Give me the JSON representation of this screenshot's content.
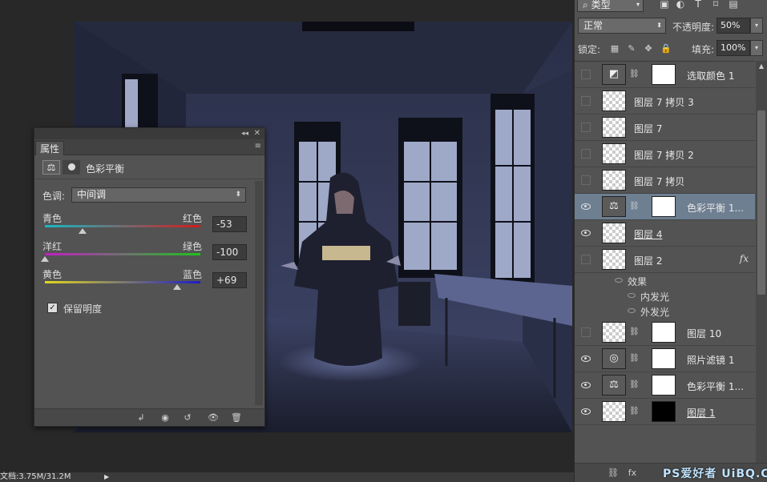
{
  "properties_panel": {
    "tab_label": "属性",
    "title": "色彩平衡",
    "collapse_glyph": "◂◂",
    "close_glyph": "✕",
    "menu_glyph": "≡",
    "balance_icon_glyph": "⚖",
    "tone_label": "色调:",
    "tone_value": "中间调",
    "sliders": [
      {
        "left": "青色",
        "right": "红色",
        "value": "-53",
        "percent": 24
      },
      {
        "left": "洋红",
        "right": "绿色",
        "value": "-100",
        "percent": 0
      },
      {
        "left": "黄色",
        "right": "蓝色",
        "value": "+69",
        "percent": 85
      }
    ],
    "preserve_label": "保留明度",
    "preserve_checked_glyph": "✓",
    "bottom_glyphs": {
      "clip": "↲",
      "view_prev": "◉",
      "reset": "↺",
      "visibility": "👁",
      "delete": "🗑"
    }
  },
  "status_bar": {
    "text": "文档:3.75M/31.2M",
    "arrow": "▶"
  },
  "layers_panel": {
    "filter_kind": "类型",
    "filter_search_glyph": "⌕",
    "filter_icons": [
      "▣",
      "◐",
      "T",
      "⌑",
      "▤"
    ],
    "blend_mode": "正常",
    "opacity_label": "不透明度:",
    "opacity_value": "50%",
    "lock_label": "锁定:",
    "lock_icons": [
      "▦",
      "✎",
      "✥",
      "🔒"
    ],
    "fill_label": "填充:",
    "fill_value": "100%",
    "dropdown_arrow": "▾",
    "chain_glyph": "⛓",
    "clip_glyph": "↲",
    "fx_glyph": "fx",
    "layers": [
      {
        "name": "选取颜色 1",
        "visible": false,
        "thumb": "adj",
        "thumb_glyph": "◩",
        "mask": "white"
      },
      {
        "name": "图层 7 拷贝 3",
        "visible": false,
        "thumb": "checker"
      },
      {
        "name": "图层 7",
        "visible": false,
        "thumb": "checker"
      },
      {
        "name": "图层 7 拷贝 2",
        "visible": false,
        "thumb": "checker"
      },
      {
        "name": "图层 7 拷贝",
        "visible": false,
        "thumb": "checker"
      },
      {
        "name": "色彩平衡 1...",
        "visible": true,
        "thumb": "adj",
        "thumb_glyph": "⚖",
        "mask": "white",
        "clipped": true,
        "selected": true
      },
      {
        "name": "图层 4",
        "visible": true,
        "thumb": "checker",
        "underline": true
      },
      {
        "name": "图层 2",
        "visible": false,
        "thumb": "checker",
        "fx": true
      },
      {
        "name": "图层 10",
        "visible": false,
        "thumb": "checker",
        "mask": "white",
        "clipped": true
      },
      {
        "name": "照片滤镜 1",
        "visible": true,
        "thumb": "adj",
        "thumb_glyph": "◎",
        "mask": "white",
        "clipped": true
      },
      {
        "name": "色彩平衡 1...",
        "visible": true,
        "thumb": "adj",
        "thumb_glyph": "⚖",
        "mask": "white",
        "clipped": true
      },
      {
        "name": "图层 1",
        "visible": true,
        "thumb": "checker",
        "mask": "black",
        "underline": true
      }
    ],
    "effects": {
      "header": "效果",
      "items": [
        "内发光",
        "外发光"
      ]
    },
    "bottom_glyphs": [
      "⛓",
      "fx"
    ],
    "watermark": "PS爱好者 UiBQ.CoM"
  },
  "colors": {
    "selected_row": "#6e7f92",
    "panel_bg": "#535353",
    "canvas_bg": "#282828"
  }
}
